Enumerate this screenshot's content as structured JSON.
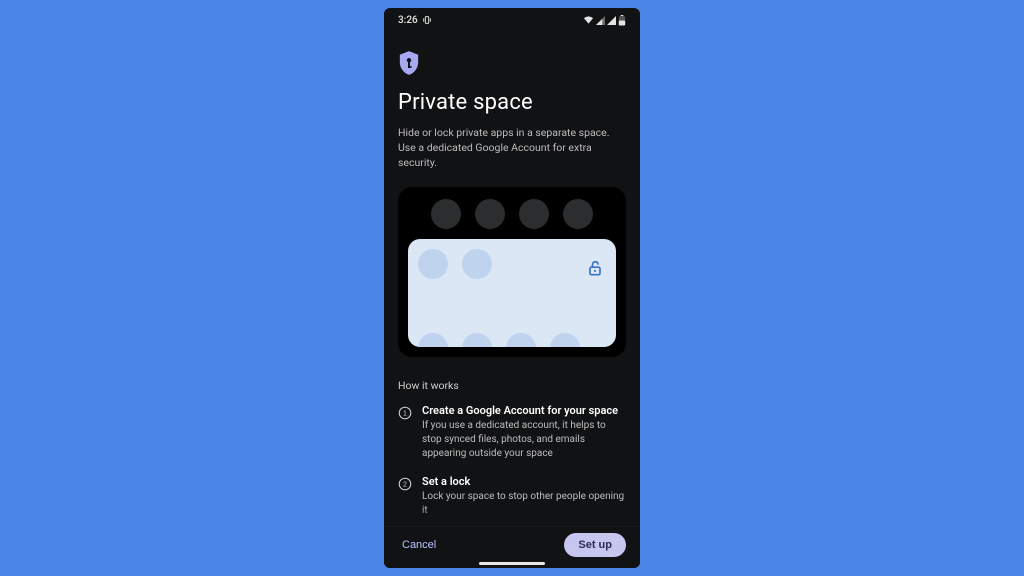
{
  "status": {
    "time": "3:26"
  },
  "header": {
    "title": "Private space",
    "subtitle": "Hide or lock private apps in a separate space. Use a dedicated Google Account for extra security."
  },
  "howitworks": {
    "label": "How it works",
    "steps": [
      {
        "num": "1",
        "title": "Create a Google Account for your space",
        "body": "If you use a dedicated account, it helps to stop synced files, photos, and emails appearing outside your space"
      },
      {
        "num": "2",
        "title": "Set a lock",
        "body": "Lock your space to stop other people opening it"
      }
    ]
  },
  "buttons": {
    "cancel": "Cancel",
    "setup": "Set up"
  },
  "colors": {
    "accent": "#a6a9f0",
    "background": "#4b85e8"
  }
}
